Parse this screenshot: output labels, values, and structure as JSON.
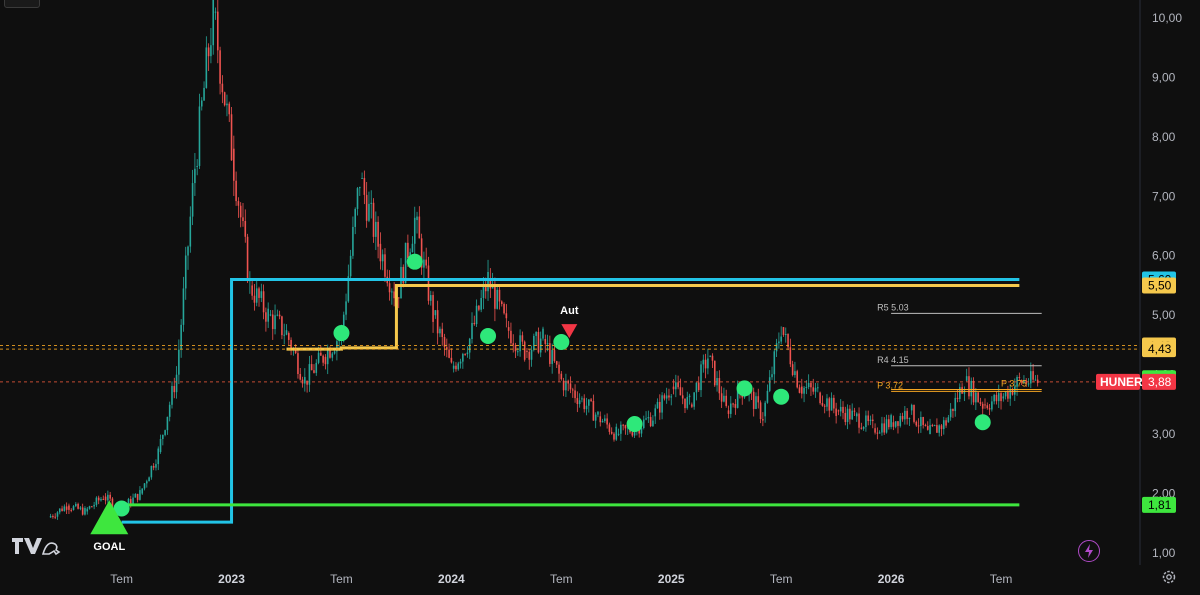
{
  "symbol": "HUNER",
  "last_price": "3,88",
  "chart_data": {
    "type": "line",
    "title": "",
    "xlabel": "",
    "ylabel": "",
    "y_tick_labels": [
      "10,00",
      "9,00",
      "8,00",
      "7,00",
      "6,00",
      "5,00",
      "4,00",
      "3,00",
      "2,00",
      "1,00"
    ],
    "y_ticks": [
      10,
      9,
      8,
      7,
      6,
      5,
      4,
      3,
      2,
      1
    ],
    "ylim": [
      0.8,
      10.3
    ],
    "x_tick_labels": [
      "Tem",
      "2023",
      "Tem",
      "2024",
      "Tem",
      "2025",
      "Tem",
      "2026",
      "Tem"
    ],
    "x_ticks": [
      "2022-07",
      "2023-01",
      "2023-07",
      "2024-01",
      "2024-07",
      "2025-01",
      "2025-07",
      "2026-01",
      "2026-07"
    ],
    "x_range": [
      "2022-02",
      "2026-10"
    ],
    "grid": false,
    "colors": {
      "up": "#26a69a",
      "down": "#ef5350",
      "cyan": "#22c4e6",
      "yellow": "#f5c84c",
      "green": "#3ee63e",
      "marker": "#2ee87a",
      "orange": "#f5a623"
    },
    "price_series": [
      {
        "t": "2022-03",
        "v": 1.6
      },
      {
        "t": "2022-04",
        "v": 1.8
      },
      {
        "t": "2022-05",
        "v": 1.7
      },
      {
        "t": "2022-06",
        "v": 1.95
      },
      {
        "t": "2022-07",
        "v": 1.75
      },
      {
        "t": "2022-08",
        "v": 2.0
      },
      {
        "t": "2022-09",
        "v": 2.7
      },
      {
        "t": "2022-10",
        "v": 4.0
      },
      {
        "t": "2022-11",
        "v": 7.5
      },
      {
        "t": "2022-12",
        "v": 10.1
      },
      {
        "t": "2023-01",
        "v": 7.8
      },
      {
        "t": "2023-02",
        "v": 5.5
      },
      {
        "t": "2023-03",
        "v": 5.0
      },
      {
        "t": "2023-04",
        "v": 4.7
      },
      {
        "t": "2023-05",
        "v": 3.9
      },
      {
        "t": "2023-06",
        "v": 4.3
      },
      {
        "t": "2023-07",
        "v": 4.7
      },
      {
        "t": "2023-08",
        "v": 7.3
      },
      {
        "t": "2023-09",
        "v": 6.2
      },
      {
        "t": "2023-10",
        "v": 5.3
      },
      {
        "t": "2023-11",
        "v": 6.6
      },
      {
        "t": "2023-12",
        "v": 5.0
      },
      {
        "t": "2024-01",
        "v": 4.1
      },
      {
        "t": "2024-02",
        "v": 4.6
      },
      {
        "t": "2024-03",
        "v": 5.6
      },
      {
        "t": "2024-04",
        "v": 4.8
      },
      {
        "t": "2024-05",
        "v": 4.4
      },
      {
        "t": "2024-06",
        "v": 4.6
      },
      {
        "t": "2024-07",
        "v": 3.9
      },
      {
        "t": "2024-08",
        "v": 3.6
      },
      {
        "t": "2024-09",
        "v": 3.3
      },
      {
        "t": "2024-10",
        "v": 3.0
      },
      {
        "t": "2024-11",
        "v": 3.1
      },
      {
        "t": "2024-12",
        "v": 3.3
      },
      {
        "t": "2025-01",
        "v": 3.8
      },
      {
        "t": "2025-02",
        "v": 3.5
      },
      {
        "t": "2025-03",
        "v": 4.3
      },
      {
        "t": "2025-04",
        "v": 3.4
      },
      {
        "t": "2025-05",
        "v": 3.8
      },
      {
        "t": "2025-06",
        "v": 3.3
      },
      {
        "t": "2025-07",
        "v": 4.8
      },
      {
        "t": "2025-08",
        "v": 3.8
      },
      {
        "t": "2025-09",
        "v": 3.7
      },
      {
        "t": "2025-10",
        "v": 3.4
      },
      {
        "t": "2025-11",
        "v": 3.3
      },
      {
        "t": "2025-12",
        "v": 3.1
      },
      {
        "t": "2026-01",
        "v": 3.2
      },
      {
        "t": "2026-02",
        "v": 3.4
      },
      {
        "t": "2026-03",
        "v": 3.0
      },
      {
        "t": "2026-04",
        "v": 3.2
      },
      {
        "t": "2026-05",
        "v": 3.9
      },
      {
        "t": "2026-06",
        "v": 3.5
      },
      {
        "t": "2026-07",
        "v": 3.6
      },
      {
        "t": "2026-08",
        "v": 3.9
      },
      {
        "t": "2026-09",
        "v": 3.88
      }
    ],
    "step_lines": [
      {
        "color": "#22c4e6",
        "points": [
          {
            "t": "2022-07",
            "v": 1.52
          },
          {
            "t": "2023-01",
            "v": 1.52
          },
          {
            "t": "2023-01",
            "v": 5.6
          },
          {
            "t": "2026-08",
            "v": 5.6
          }
        ]
      },
      {
        "color": "#f5c84c",
        "points": [
          {
            "t": "2023-04",
            "v": 4.43
          },
          {
            "t": "2023-07",
            "v": 4.43
          },
          {
            "t": "2023-07",
            "v": 4.45
          },
          {
            "t": "2023-10",
            "v": 4.45
          },
          {
            "t": "2023-10",
            "v": 5.5
          },
          {
            "t": "2026-08",
            "v": 5.5
          }
        ]
      },
      {
        "color": "#3ee63e",
        "points": [
          {
            "t": "2022-07",
            "v": 1.81
          },
          {
            "t": "2026-08",
            "v": 1.81
          }
        ]
      }
    ],
    "dashed_levels": [
      {
        "v": 4.49,
        "color": "#f5a623"
      },
      {
        "v": 4.43,
        "color": "#f5a623"
      },
      {
        "v": 3.88,
        "color": "#e0553a"
      }
    ],
    "pivot_levels": [
      {
        "label": "R5",
        "value": "5.03",
        "v": 5.03,
        "color": "#bfbfbf"
      },
      {
        "label": "R4",
        "value": "4.15",
        "v": 4.15,
        "color": "#bfbfbf"
      },
      {
        "label": "P",
        "value": "3.72",
        "v": 3.72,
        "color": "#f5a623"
      },
      {
        "label": "P",
        "value": "3.75",
        "v": 3.75,
        "color": "#f5a623"
      }
    ],
    "markers": [
      {
        "t": "2022-07",
        "v": 1.75
      },
      {
        "t": "2023-07",
        "v": 4.7
      },
      {
        "t": "2023-11",
        "v": 5.9
      },
      {
        "t": "2024-03",
        "v": 4.65
      },
      {
        "t": "2024-07",
        "v": 4.55
      },
      {
        "t": "2024-11",
        "v": 3.17
      },
      {
        "t": "2025-05",
        "v": 3.77
      },
      {
        "t": "2025-07",
        "v": 3.63
      },
      {
        "t": "2026-06",
        "v": 3.2
      }
    ],
    "goal": {
      "label": "GOAL",
      "t": "2022-06",
      "v": 1.62
    },
    "sell_signal": {
      "label": "Aut",
      "t": "2024-07",
      "v": 4.85
    },
    "price_tags": [
      {
        "label": "5,60",
        "v": 5.6,
        "bg": "#22c4e6",
        "fg": "#000000"
      },
      {
        "label": "5,50",
        "v": 5.5,
        "bg": "#f5c84c",
        "fg": "#000000"
      },
      {
        "label": "4,49",
        "v": 4.49,
        "bg": "#f5c84c",
        "fg": "#000000"
      },
      {
        "label": "4,43",
        "v": 4.43,
        "bg": "#f5c84c",
        "fg": "#000000"
      },
      {
        "label": "3,94",
        "v": 3.94,
        "bg": "#3ee63e",
        "fg": "#000000"
      },
      {
        "label": "3,88",
        "v": 3.88,
        "bg": "#f23645",
        "fg": "#ffffff"
      },
      {
        "label": "1,81",
        "v": 1.81,
        "bg": "#3ee63e",
        "fg": "#000000"
      }
    ]
  }
}
